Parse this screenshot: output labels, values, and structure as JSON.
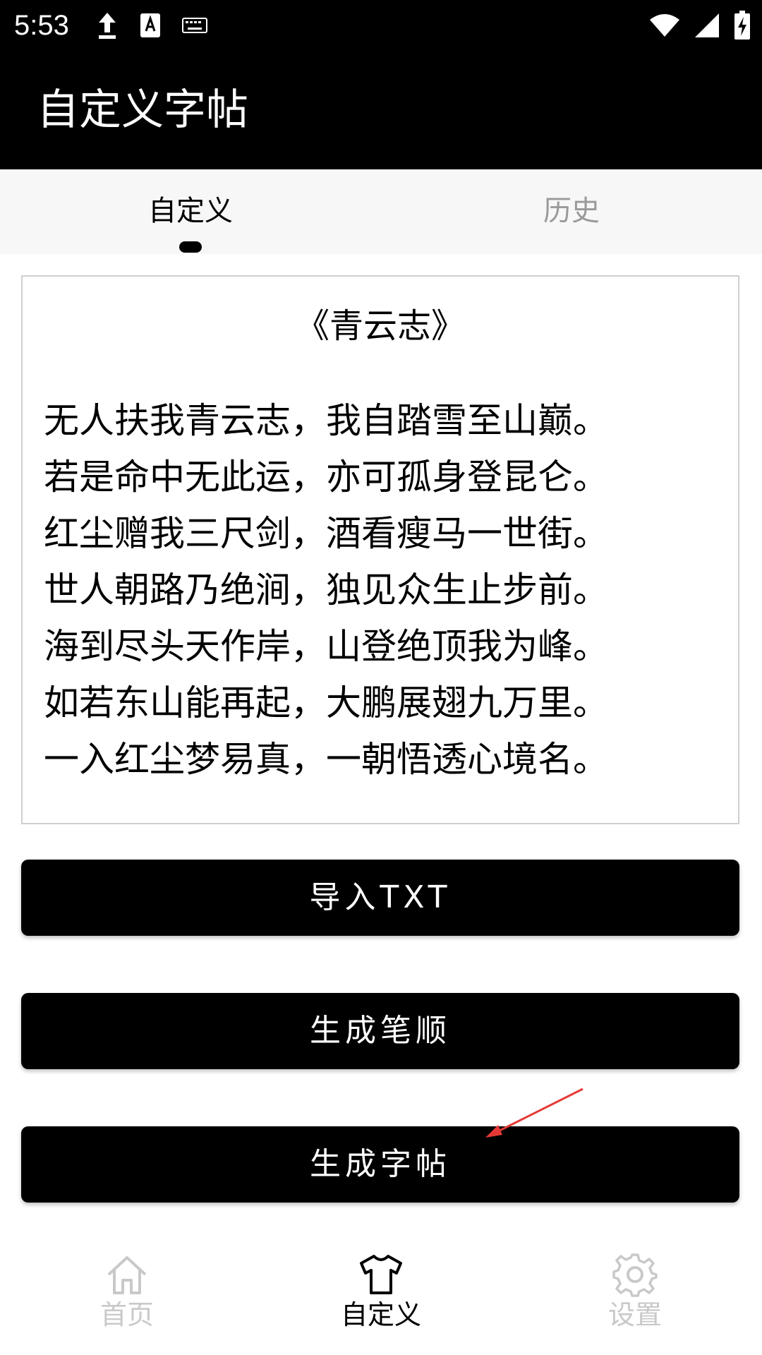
{
  "status_bar": {
    "time": "5:53",
    "icons": [
      "upload-icon",
      "text-icon",
      "keyboard-icon",
      "wifi-icon",
      "signal-icon",
      "battery-charging-icon"
    ]
  },
  "app_bar": {
    "title": "自定义字帖"
  },
  "tabs": [
    {
      "label": "自定义",
      "selected": true
    },
    {
      "label": "历史",
      "selected": false
    }
  ],
  "poem": {
    "title": "《青云志》",
    "lines": [
      "无人扶我青云志，我自踏雪至山巅。",
      "若是命中无此运，亦可孤身登昆仑。",
      "红尘赠我三尺剑，酒看瘦马一世街。",
      "世人朝路乃绝涧，独见众生止步前。",
      "海到尽头天作岸，山登绝顶我为峰。",
      "如若东山能再起，大鹏展翅九万里。",
      "一入红尘梦易真，一朝悟透心境名。"
    ]
  },
  "buttons": {
    "import": "导入TXT",
    "stroke_order": "生成笔顺",
    "copybook": "生成字帖"
  },
  "bottom_nav": [
    {
      "label": "首页",
      "icon": "home-icon",
      "active": false
    },
    {
      "label": "自定义",
      "icon": "tshirt-icon",
      "active": true
    },
    {
      "label": "设置",
      "icon": "gear-icon",
      "active": false
    }
  ],
  "colors": {
    "primary": "#000000",
    "inactive": "#c9c9c9",
    "tab_inactive": "#9a9a9a",
    "annotation_arrow": "#e53935"
  }
}
